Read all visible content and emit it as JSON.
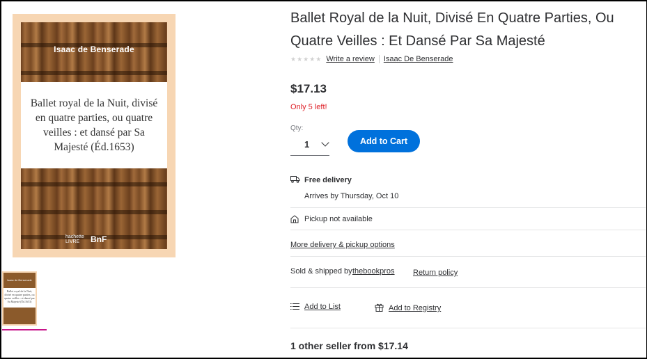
{
  "product": {
    "title": "Ballet Royal de la Nuit, Divisé En Quatre Parties, Ou Quatre Veilles : Et Dansé Par Sa Majesté",
    "write_review": "Write a review",
    "author_link": "Isaac De Benserade",
    "price": "$17.13",
    "stock_notice": "Only 5 left!",
    "colors": {
      "stock": "#de1c24",
      "button": "#0071dc",
      "thumb_active": "#c7158a"
    }
  },
  "cover": {
    "author": "Isaac de Benserade",
    "title": "Ballet royal de la Nuit, divisé en quatre parties, ou quatre veilles : et dansé par Sa Majesté (Éd.1653)",
    "publisher": "hachette LIVRE",
    "bnf": "BnF"
  },
  "thumb": {
    "author": "Isaac de Benserade",
    "title": "Ballet royal de la Nuit, divisé en quatre parties, ou quatre veilles : et dansé par Sa Majesté (Éd.1653)"
  },
  "purchase": {
    "qty_label": "Qty:",
    "qty_value": "1",
    "add_to_cart": "Add to Cart"
  },
  "fulfillment": {
    "free_delivery": "Free delivery",
    "arrives": "Arrives by Thursday, Oct 10",
    "pickup": "Pickup not available",
    "more_options": "More delivery & pickup options"
  },
  "seller": {
    "sold_by": "Sold & shipped by",
    "seller_name": "thebookpros",
    "return_policy": "Return policy"
  },
  "actions": {
    "add_to_list": "Add to List",
    "add_to_registry": "Add to Registry"
  },
  "other_sellers": "1 other seller from $17.14",
  "icons": [
    "truck-icon",
    "store-icon",
    "list-icon",
    "gift-icon",
    "chevron-down-icon",
    "star-icon"
  ]
}
